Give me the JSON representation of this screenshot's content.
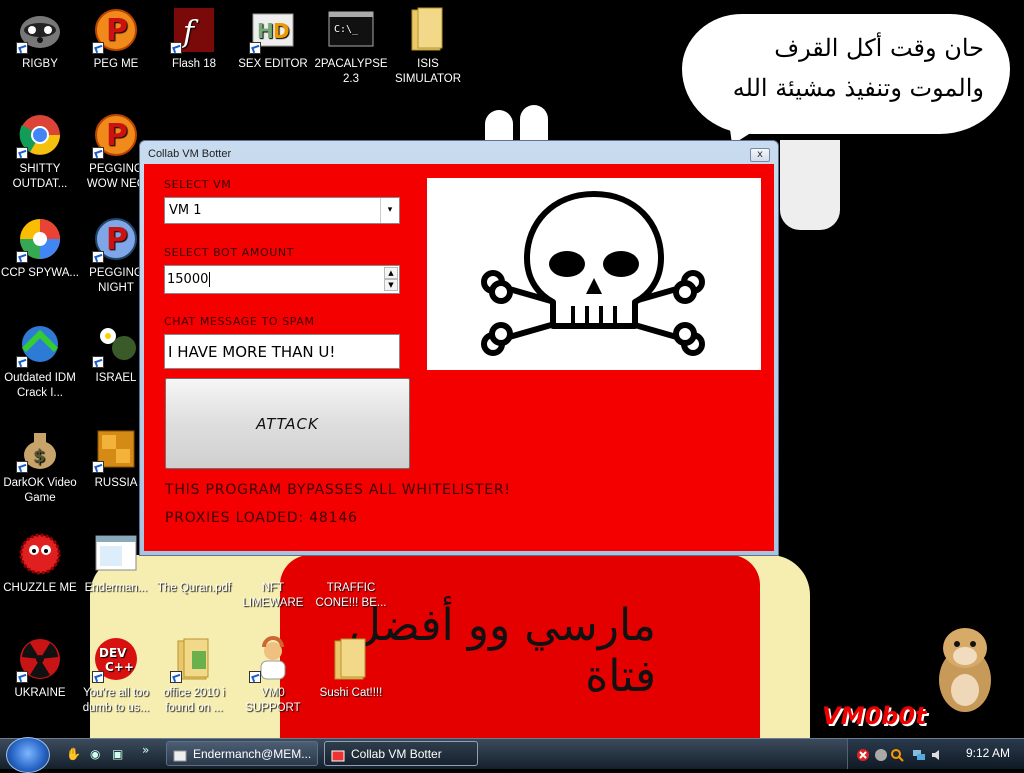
{
  "desktop": {
    "icons": [
      {
        "label": "RIGBY"
      },
      {
        "label": "PEG ME"
      },
      {
        "label": "Flash 18"
      },
      {
        "label": "SEX EDITOR"
      },
      {
        "label": "2PACALYPSE 2.3"
      },
      {
        "label": "ISIS SIMULATOR"
      },
      {
        "label": "SHITTY OUTDAT..."
      },
      {
        "label": "PEGGING WOW NEC"
      },
      {
        "label": "CCP SPYWA..."
      },
      {
        "label": "PEGGING NIGHT"
      },
      {
        "label": "Outdated IDM Crack I..."
      },
      {
        "label": "ISRAEL"
      },
      {
        "label": "DarkOK Video Game"
      },
      {
        "label": "RUSSIA"
      },
      {
        "label": "CHUZZLE ME"
      },
      {
        "label": "Enderman..."
      },
      {
        "label": "The Quran.pdf"
      },
      {
        "label": "NFT LIMEWARE"
      },
      {
        "label": "TRAFFIC CONE!!! BE..."
      },
      {
        "label": "UKRAINE"
      },
      {
        "label": "You're all too dumb to us..."
      },
      {
        "label": "office 2010 i found on ..."
      },
      {
        "label": "VM0 SUPPORT"
      },
      {
        "label": "Sushi Cat!!!!"
      }
    ]
  },
  "wallpaper": {
    "bubble_line1": "حان وقت أكل القرف",
    "bubble_line2": "والموت وتنفيذ مشيئة الله",
    "bottom_text": "مارسي وو أفضل فتاة",
    "logo": "VM0b0t"
  },
  "window": {
    "title": "Collab VM Botter",
    "close_glyph": "x",
    "select_vm_label": "SELECT VM",
    "select_vm_value": "VM 1",
    "bot_amount_label": "SELECT BOT AMOUNT",
    "bot_amount_value": "15000",
    "chat_label": "CHAT MESSAGE TO SPAM",
    "chat_value": "I HAVE MORE THAN U!",
    "attack_label": "ATTACK",
    "bypass_text": "THIS PROGRAM BYPASSES ALL WHITELISTER!",
    "proxies_text": "PROXIES LOADED: 48146"
  },
  "taskbar": {
    "tasks": [
      {
        "label": "Endermanch@MEM..."
      },
      {
        "label": "Collab VM Botter"
      }
    ],
    "clock": "9:12 AM"
  },
  "colors": {
    "client_bg": "#f40000",
    "label_text": "#3a0000",
    "taskbar": "#1b2633"
  }
}
